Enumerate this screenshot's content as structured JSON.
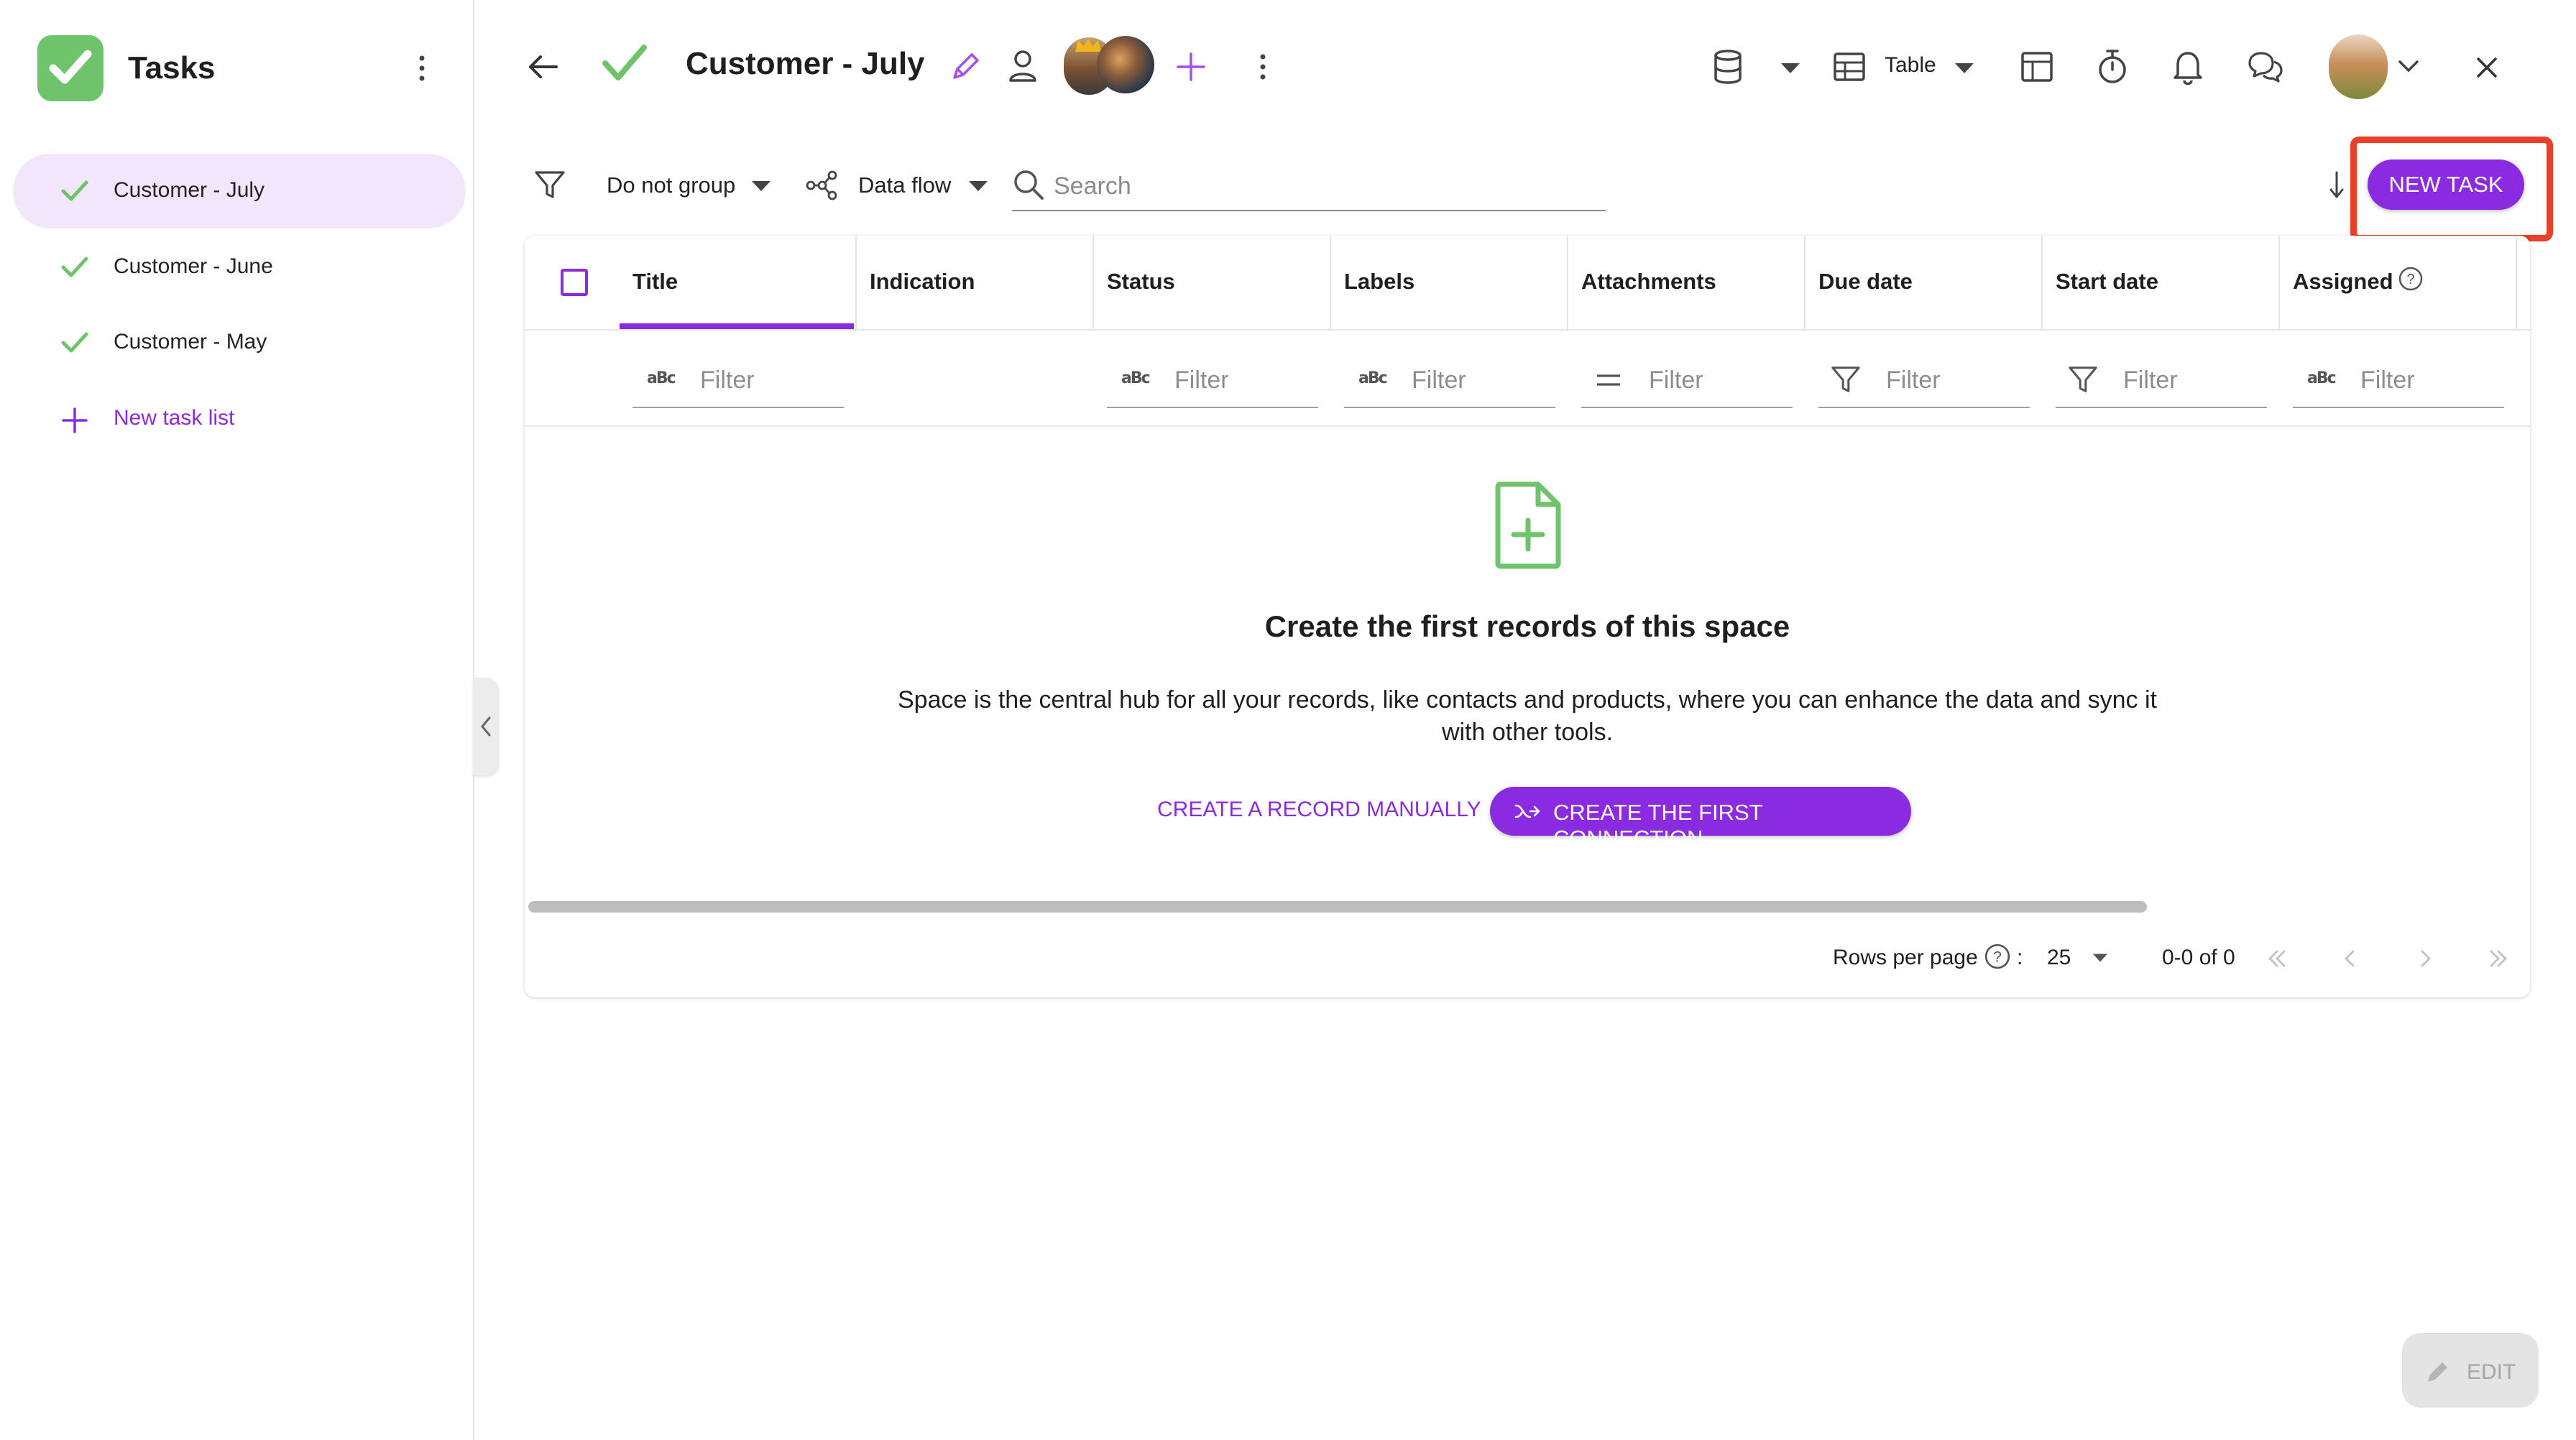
{
  "sidebar": {
    "app_title": "Tasks",
    "items": [
      {
        "label": "Customer - July",
        "active": true
      },
      {
        "label": "Customer - June",
        "active": false
      },
      {
        "label": "Customer - May",
        "active": false
      }
    ],
    "new_list_label": "New task list"
  },
  "header": {
    "title": "Customer - July",
    "view_label": "Table"
  },
  "toolbar": {
    "group_label": "Do not group",
    "dataflow_label": "Data flow",
    "search_placeholder": "Search",
    "new_task_label": "NEW TASK"
  },
  "table": {
    "columns": [
      {
        "title": "Title"
      },
      {
        "title": "Indication"
      },
      {
        "title": "Status"
      },
      {
        "title": "Labels"
      },
      {
        "title": "Attachments"
      },
      {
        "title": "Due date"
      },
      {
        "title": "Start date"
      },
      {
        "title": "Assigned"
      }
    ],
    "filter_placeholder": "Filter",
    "abc_glyph": "aBc"
  },
  "empty_state": {
    "title": "Create the first records of this space",
    "description": "Space is the central hub for all your records, like contacts and products, where you can enhance the data and sync it with other tools.",
    "manual_label": "CREATE A RECORD MANUALLY",
    "connection_label": "CREATE THE FIRST CONNECTION"
  },
  "pagination": {
    "rows_per_page_label": "Rows per page",
    "colon": ":",
    "rows_per_page_value": "25",
    "range": "0-0 of 0"
  },
  "fab": {
    "edit_label": "EDIT"
  },
  "colors": {
    "accent": "#8a2be2",
    "green": "#6fc36b",
    "highlight": "#e8402a"
  }
}
